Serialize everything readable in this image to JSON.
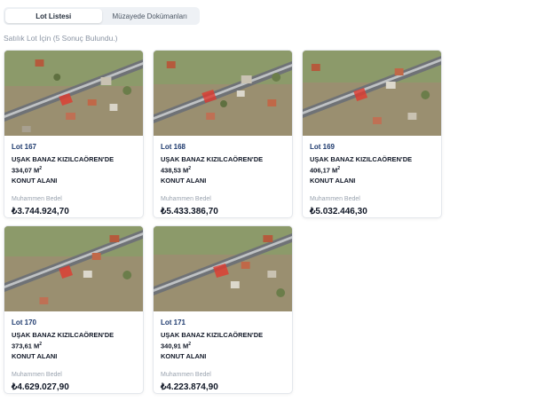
{
  "tabs": [
    {
      "label": "Lot Listesi",
      "active": true
    },
    {
      "label": "Müzayede Dokümanları",
      "active": false
    }
  ],
  "result_text": "Satılık Lot İçin (5 Sonuç Bulundu.)",
  "price_label": "Muhammen Bedel",
  "lots": [
    {
      "lot_no": "Lot 167",
      "title_pre": "UŞAK BANAZ KIZILCAÖREN'DE 334,07 M",
      "title_sup": "2",
      "title_post": "KONUT ALANI",
      "price": "₺3.744.924,70"
    },
    {
      "lot_no": "Lot 168",
      "title_pre": "UŞAK BANAZ KIZILCAÖREN'DE 438,53 M",
      "title_sup": "2",
      "title_post": "KONUT ALANI",
      "price": "₺5.433.386,70"
    },
    {
      "lot_no": "Lot 169",
      "title_pre": "UŞAK BANAZ KIZILCAÖREN'DE 406,17 M",
      "title_sup": "2",
      "title_post": "KONUT ALANI",
      "price": "₺5.032.446,30"
    },
    {
      "lot_no": "Lot 170",
      "title_pre": "UŞAK BANAZ KIZILCAÖREN'DE 373,61 M",
      "title_sup": "2",
      "title_post": "KONUT ALANI",
      "price": "₺4.629.027,90"
    },
    {
      "lot_no": "Lot 171",
      "title_pre": "UŞAK BANAZ KIZILCAÖREN'DE 340,91 M",
      "title_sup": "2",
      "title_post": "KONUT ALANI",
      "price": "₺4.223.874,90"
    }
  ],
  "colors": {
    "lot_no": "#1e3a6e",
    "parcel_highlight": "#e0392f"
  }
}
